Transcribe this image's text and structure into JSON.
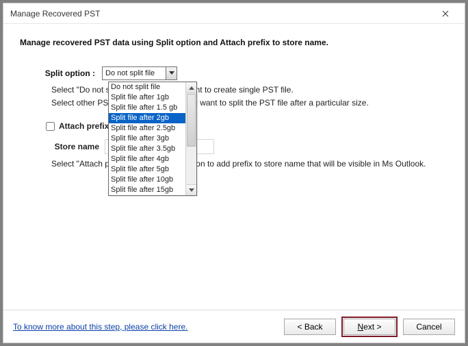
{
  "titlebar": {
    "title": "Manage Recovered PST"
  },
  "heading": "Manage recovered PST data using Split option and Attach prefix to store name.",
  "split": {
    "label": "Split option :",
    "selected": "Do not split file",
    "options": [
      "Do not split file",
      "Split file after 1gb",
      "Split file after 1.5 gb",
      "Split file after 2gb",
      "Split file after 2.5gb",
      "Split file after 3gb",
      "Split file after 3.5gb",
      "Split file after 4gb",
      "Split file after 5gb",
      "Split file after 10gb",
      "Split file after 15gb"
    ],
    "highlight_index": 3,
    "help_line1": "Select \"Do not split file\" option if you want to create single PST file.",
    "help_line2": "Select other PST split size options if you want to split the PST file after a particular size."
  },
  "attach": {
    "checkbox_label": "Attach prefix to store name",
    "store_label": "Store name",
    "store_value": "",
    "help": "Select \"Attach prefix to store name\" option to add prefix to store name that will be visible in Ms Outlook."
  },
  "footer": {
    "learn_more": "To know more about this step, please click here.",
    "back": "< Back",
    "next_prefix": "N",
    "next_rest": "ext >",
    "cancel": "Cancel"
  }
}
